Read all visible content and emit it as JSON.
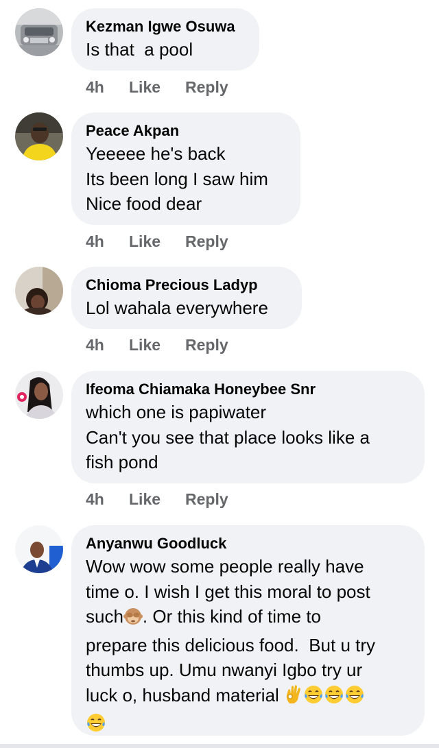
{
  "colors": {
    "bubble_bg": "#f0f2f5",
    "author_text": "#050505",
    "meta_text": "#65676b"
  },
  "comments": [
    {
      "author": "Kezman Igwe Osuwa",
      "lines": [
        "Is that  a pool"
      ],
      "time": "4h",
      "like_label": "Like",
      "reply_label": "Reply"
    },
    {
      "author": "Peace Akpan",
      "lines": [
        "Yeeeee he's back",
        "Its been long I saw him",
        "Nice food dear"
      ],
      "time": "4h",
      "like_label": "Like",
      "reply_label": "Reply"
    },
    {
      "author": "Chioma Precious Ladyp",
      "lines": [
        "Lol wahala everywhere"
      ],
      "time": "4h",
      "like_label": "Like",
      "reply_label": "Reply"
    },
    {
      "author": "Ifeoma Chiamaka Honeybee Snr",
      "lines": [
        "which one is papiwater",
        "Can't you see that place looks like a",
        "fish pond"
      ],
      "time": "4h",
      "like_label": "Like",
      "reply_label": "Reply"
    },
    {
      "author": "Anyanwu Goodluck",
      "lines": [
        "Wow wow some people really have",
        "time o. I wish I get this moral to post",
        "such",
        ". Or this kind of time to",
        "prepare this delicious food.  But u try",
        "thumbs up. Umu nwanyi Igbo try ur",
        "luck o, husband material"
      ],
      "emojis": [
        "see-no-evil-monkey-icon",
        "ok-hand-icon",
        "tears-of-joy-icon"
      ],
      "time": "",
      "like_label": "",
      "reply_label": ""
    }
  ]
}
